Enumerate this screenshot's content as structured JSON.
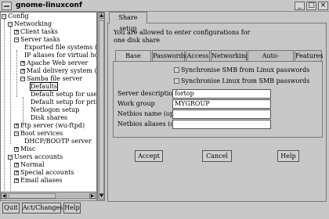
{
  "window": {
    "title": "gnome-linuxconf",
    "minimize_glyph": "_",
    "maximize_glyph": "□",
    "close_glyph": "×"
  },
  "tree": {
    "items": [
      {
        "label": "Config",
        "expander": "−"
      },
      {
        "label": "Networking",
        "expander": "−"
      },
      {
        "label": "Client tasks",
        "expander": "+"
      },
      {
        "label": "Server tasks",
        "expander": "−"
      },
      {
        "label": "Exported file systems (NFS",
        "expander": ""
      },
      {
        "label": "IP aliases for virtual hosts",
        "expander": ""
      },
      {
        "label": "Apache Web server",
        "expander": "+"
      },
      {
        "label": "Mail delivery system (send",
        "expander": "+"
      },
      {
        "label": "Samba file server",
        "expander": "−"
      },
      {
        "label": "Defaults",
        "expander": ""
      },
      {
        "label": "Default setup for users's h",
        "expander": ""
      },
      {
        "label": "Default setup for printers",
        "expander": ""
      },
      {
        "label": "Netlogon setup",
        "expander": ""
      },
      {
        "label": "Disk shares",
        "expander": ""
      },
      {
        "label": "Ftp server (wu-ftpd)",
        "expander": "+"
      },
      {
        "label": "Boot services",
        "expander": "−"
      },
      {
        "label": "DHCP/BOOTP server",
        "expander": ""
      },
      {
        "label": "Misc",
        "expander": "+"
      },
      {
        "label": "Users accounts",
        "expander": "−"
      },
      {
        "label": "Normal",
        "expander": "+"
      },
      {
        "label": "Special accounts",
        "expander": "+"
      },
      {
        "label": "Email aliases",
        "expander": "+"
      }
    ]
  },
  "bottom_buttons": {
    "quit": "Quit",
    "act_changes": "Act/Changes",
    "help": "Help"
  },
  "main": {
    "tab_label": "Share setup",
    "intro": "You are allowed to enter configurations for one disk share",
    "inner_tabs": [
      "Base config",
      "Passwords",
      "Access",
      "Networking",
      "Auto-accounts",
      "Features"
    ],
    "checkbox1": "Synchronise SMB from Linux passwords",
    "checkbox2": "Synchronise Linux from SMB passwords",
    "fields": {
      "server_description": {
        "label": "Server description",
        "value": "fortop"
      },
      "work_group": {
        "label": "Work group",
        "value": "MYGROUP"
      },
      "netbios_name": {
        "label": "Netbios name (opt)",
        "value": ""
      },
      "netbios_aliases": {
        "label": "Netbios aliases (opt)",
        "value": ""
      }
    },
    "buttons": {
      "accept": "Accept",
      "cancel": "Cancel",
      "help": "Help"
    }
  }
}
